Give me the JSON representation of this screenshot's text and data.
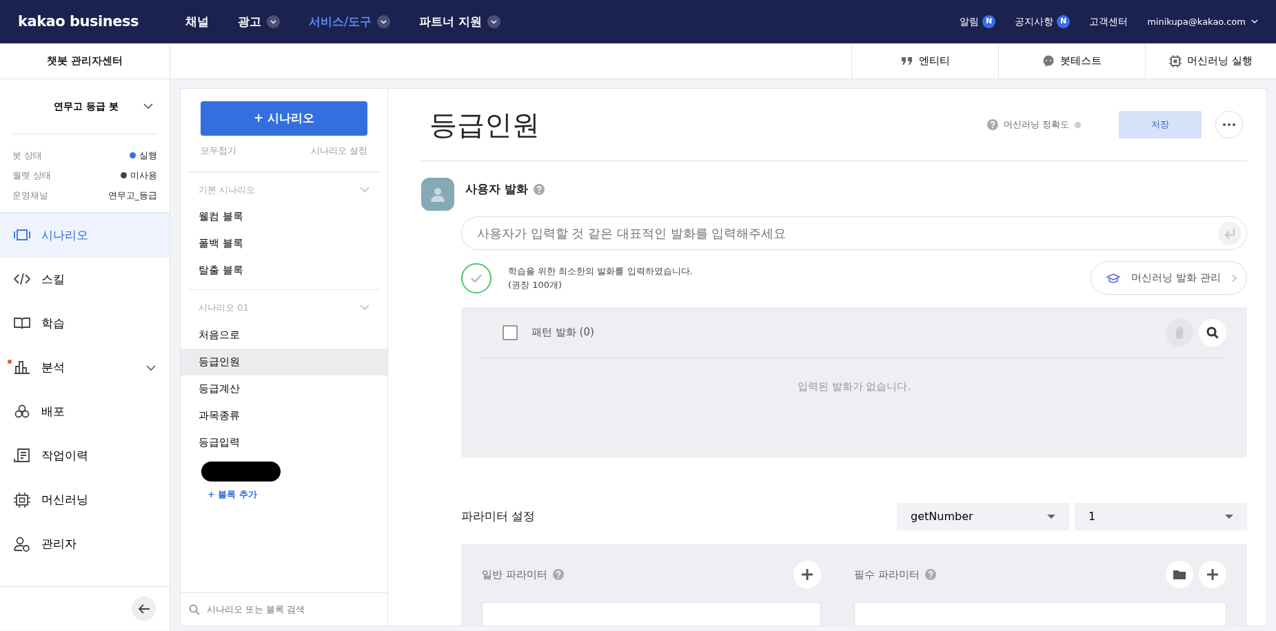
{
  "header": {
    "logo": "kakao business",
    "nav": [
      {
        "label": "채널",
        "dropdown": false,
        "selected": false
      },
      {
        "label": "광고",
        "dropdown": true,
        "selected": false
      },
      {
        "label": "서비스/도구",
        "dropdown": true,
        "selected": true
      },
      {
        "label": "파트너 지원",
        "dropdown": true,
        "selected": false
      }
    ],
    "links": [
      {
        "label": "알림",
        "badge": "N"
      },
      {
        "label": "공지사항",
        "badge": "N"
      },
      {
        "label": "고객센터"
      }
    ],
    "account": "minikupa@kakao.com"
  },
  "subheader": {
    "title": "챗봇 관리자센터",
    "tools": [
      "엔티티",
      "봇테스트",
      "머신러닝 실행"
    ]
  },
  "sidebar": {
    "bot_name": "연무고 등급 봇",
    "status": [
      {
        "label": "봇 상태",
        "value": "실행",
        "color": "#3a6fe0"
      },
      {
        "label": "월렛 상태",
        "value": "미사용",
        "color": "#444444"
      },
      {
        "label": "운영채널",
        "value": "연무고_등급"
      }
    ],
    "menu": [
      {
        "label": "시나리오",
        "selected": true,
        "expandable": false,
        "alert": false
      },
      {
        "label": "스킬",
        "selected": false,
        "expandable": false,
        "alert": false
      },
      {
        "label": "학습",
        "selected": false,
        "expandable": false,
        "alert": false
      },
      {
        "label": "분석",
        "selected": false,
        "expandable": true,
        "alert": true
      },
      {
        "label": "배포",
        "selected": false,
        "expandable": false,
        "alert": false
      },
      {
        "label": "작업이력",
        "selected": false,
        "expandable": false,
        "alert": false
      },
      {
        "label": "머신러닝",
        "selected": false,
        "expandable": false,
        "alert": false
      },
      {
        "label": "관리자",
        "selected": false,
        "expandable": false,
        "alert": false
      }
    ]
  },
  "scenarios": {
    "add_button": "+ 시나리오",
    "collapse_all": "모두접기",
    "settings": "시나리오 설정",
    "groups": [
      {
        "title": "기본 시나리오",
        "blocks": [
          {
            "label": "웰컴 블록",
            "selected": false
          },
          {
            "label": "폴백 블록",
            "selected": false
          },
          {
            "label": "탈출 블록",
            "selected": false
          }
        ]
      },
      {
        "title": "시나리오 01",
        "blocks": [
          {
            "label": "처음으로",
            "selected": false
          },
          {
            "label": "등급인원",
            "selected": true
          },
          {
            "label": "등급계산",
            "selected": false
          },
          {
            "label": "과목종류",
            "selected": false
          },
          {
            "label": "등급입력",
            "selected": false
          }
        ]
      }
    ],
    "add_block": "+ 블록 추가",
    "search_placeholder": "시나리오 또는 블록 검색"
  },
  "block": {
    "title": "등급인원",
    "ml_accuracy": "머신러닝 정확도",
    "save": "저장",
    "save_disabled": true,
    "utterance": {
      "label": "사용자 발화",
      "placeholder": "사용자가 입력할 것 같은 대표적인 발화를 입력해주세요",
      "done": true,
      "notice": "학습을 위한 최소한의 발화를 입력하였습니다.",
      "notice_sub": "(권장 100개)",
      "ml_manage": "머신러닝 발화 관리",
      "pattern": {
        "label": "패턴 발화 (0)",
        "checked": false,
        "empty": "입력된 발화가 없습니다."
      }
    },
    "parameters": {
      "title": "파라미터 설정",
      "selects": [
        "getNumber",
        "1"
      ],
      "general": "일반 파라미터",
      "required": "필수 파라미터"
    }
  }
}
